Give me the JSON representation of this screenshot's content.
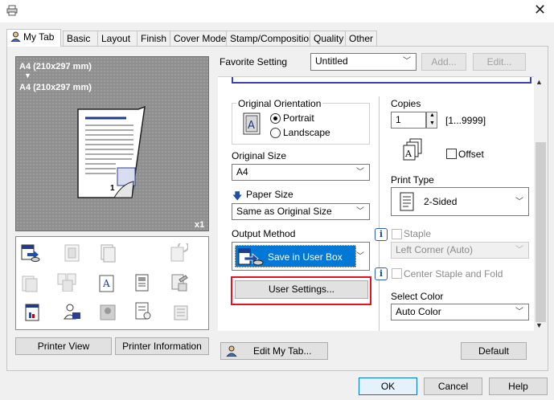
{
  "tabs": [
    {
      "label": "My Tab",
      "active": true
    },
    {
      "label": "Basic"
    },
    {
      "label": "Layout"
    },
    {
      "label": "Finish"
    },
    {
      "label": "Cover Mode"
    },
    {
      "label": "Stamp/Composition"
    },
    {
      "label": "Quality"
    },
    {
      "label": "Other"
    }
  ],
  "preview": {
    "original_size_text": "A4 (210x297 mm)",
    "arrow": "▼",
    "paper_size_text": "A4 (210x297 mm)",
    "page_number": "1",
    "copies_badge": "x1"
  },
  "left_buttons": {
    "printer_view": "Printer View",
    "printer_information": "Printer Information"
  },
  "favorite": {
    "label": "Favorite Setting",
    "value": "Untitled",
    "add": "Add...",
    "edit": "Edit..."
  },
  "orientation": {
    "legend": "Original Orientation",
    "portrait": "Portrait",
    "landscape": "Landscape",
    "selected": "Portrait"
  },
  "original_size": {
    "label": "Original Size",
    "value": "A4"
  },
  "paper_size": {
    "label": "Paper Size",
    "value": "Same as Original Size"
  },
  "output_method": {
    "label": "Output Method",
    "value": "Save in User Box",
    "user_settings": "User Settings..."
  },
  "copies": {
    "label": "Copies",
    "value": "1",
    "range": "[1...9999]",
    "offset": "Offset"
  },
  "print_type": {
    "label": "Print Type",
    "value": "2-Sided"
  },
  "staple": {
    "label": "Staple",
    "value": "Left Corner (Auto)"
  },
  "center_staple": {
    "label": "Center Staple and Fold"
  },
  "select_color": {
    "label": "Select Color",
    "value": "Auto Color"
  },
  "bottom": {
    "edit_my_tab": "Edit My Tab...",
    "default": "Default"
  },
  "dialog": {
    "ok": "OK",
    "cancel": "Cancel",
    "help": "Help"
  },
  "colors": {
    "highlight_red": "#e81123",
    "selection_blue": "#0078d7",
    "accent_blue": "#1f4ea8"
  }
}
